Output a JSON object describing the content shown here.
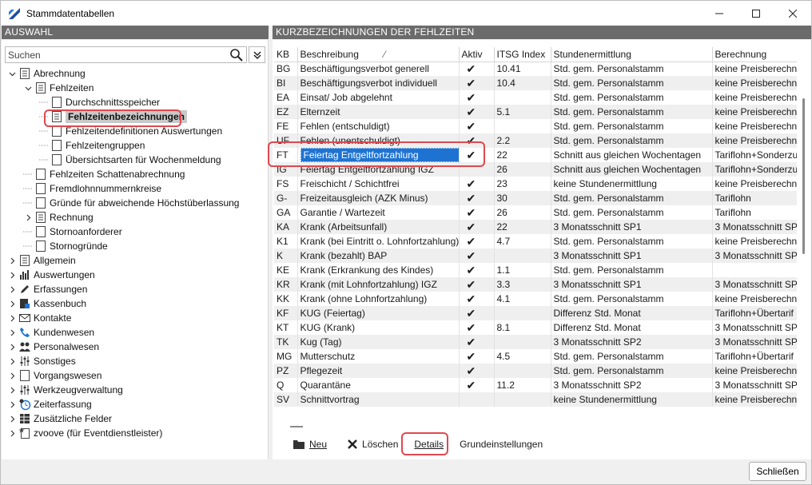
{
  "window": {
    "title": "Stammdatentabellen",
    "minimize": "—",
    "maximize": "☐",
    "close": "✕"
  },
  "left": {
    "header": "AUSWAHL",
    "search": {
      "placeholder": "Suchen",
      "value": ""
    },
    "tree": [
      {
        "label": "Abrechnung",
        "icon": "doc-list-icon",
        "level": 0,
        "expander": "open"
      },
      {
        "label": "Fehlzeiten",
        "icon": "doc-list-icon",
        "level": 1,
        "expander": "open"
      },
      {
        "label": "Durchschnittsspeicher",
        "icon": "page-icon",
        "level": 2,
        "expander": "none"
      },
      {
        "label": "Fehlzeitenbezeichnungen",
        "icon": "doc-list-icon",
        "level": 2,
        "expander": "none",
        "selected": true
      },
      {
        "label": "Fehlzeitendefinitionen Auswertungen",
        "icon": "page-icon",
        "level": 2,
        "expander": "none"
      },
      {
        "label": "Fehlzeitengruppen",
        "icon": "page-icon",
        "level": 2,
        "expander": "none"
      },
      {
        "label": "Übersichtsarten für Wochenmeldung",
        "icon": "page-icon",
        "level": 2,
        "expander": "none"
      },
      {
        "label": "Fehlzeiten Schattenabrechnung",
        "icon": "page-icon",
        "level": 1,
        "expander": "none"
      },
      {
        "label": "Fremdlohnnummernkreise",
        "icon": "page-icon",
        "level": 1,
        "expander": "none"
      },
      {
        "label": "Gründe für abweichende Höchstüberlassung",
        "icon": "page-icon",
        "level": 1,
        "expander": "none"
      },
      {
        "label": "Rechnung",
        "icon": "doc-list-icon",
        "level": 1,
        "expander": "closed"
      },
      {
        "label": "Stornoanforderer",
        "icon": "page-icon",
        "level": 1,
        "expander": "none"
      },
      {
        "label": "Stornogründe",
        "icon": "page-icon",
        "level": 1,
        "expander": "none"
      },
      {
        "label": "Allgemein",
        "icon": "doc-list-icon",
        "level": 0,
        "expander": "closed"
      },
      {
        "label": "Auswertungen",
        "icon": "bar-chart-icon",
        "level": 0,
        "expander": "closed"
      },
      {
        "label": "Erfassungen",
        "icon": "pencil-icon",
        "level": 0,
        "expander": "closed"
      },
      {
        "label": "Kassenbuch",
        "icon": "cash-book-icon",
        "level": 0,
        "expander": "closed"
      },
      {
        "label": "Kontakte",
        "icon": "envelope-icon",
        "level": 0,
        "expander": "closed"
      },
      {
        "label": "Kundenwesen",
        "icon": "phone-icon",
        "level": 0,
        "expander": "closed"
      },
      {
        "label": "Personalwesen",
        "icon": "people-icon",
        "level": 0,
        "expander": "closed"
      },
      {
        "label": "Sonstiges",
        "icon": "sliders-icon",
        "level": 0,
        "expander": "closed"
      },
      {
        "label": "Vorgangswesen",
        "icon": "page-icon",
        "level": 0,
        "expander": "closed"
      },
      {
        "label": "Werkzeugverwaltung",
        "icon": "sliders-icon",
        "level": 0,
        "expander": "closed"
      },
      {
        "label": "Zeiterfassung",
        "icon": "clock-gear-icon",
        "level": 0,
        "expander": "closed"
      },
      {
        "label": "Zusätzliche Felder",
        "icon": "grid-icon",
        "level": 0,
        "expander": "closed"
      },
      {
        "label": "zvoove (für Eventdienstleister)",
        "icon": "star-doc-icon",
        "level": 0,
        "expander": "closed"
      }
    ]
  },
  "right": {
    "header": "KURZBEZEICHNUNGEN DER FEHLZEITEN",
    "columns": [
      "KB",
      "Beschreibung",
      "Aktiv",
      "ITSG Index",
      "Stundenermittlung",
      "Berechnung"
    ],
    "sort_indicator": "⁄",
    "rows": [
      [
        "BG",
        "Beschäftigungsverbot generell",
        "✔",
        "10.41",
        "Std. gem. Personalstamm",
        "keine Preisberechnu"
      ],
      [
        "BI",
        "Beschäftigungsverbot individuell",
        "✔",
        "10.4",
        "Std. gem. Personalstamm",
        "keine Preisberechnu"
      ],
      [
        "EA",
        "Einsat/ Job abgelehnt",
        "✔",
        "",
        "Std. gem. Personalstamm",
        "keine Preisberechnu"
      ],
      [
        "EZ",
        "Elternzeit",
        "✔",
        "5.1",
        "Std. gem. Personalstamm",
        "keine Preisberechnu"
      ],
      [
        "FE",
        "Fehlen (entschuldigt)",
        "✔",
        "",
        "Std. gem. Personalstamm",
        "keine Preisberechnu"
      ],
      [
        "UF",
        "Fehlen (unentschuldigt)",
        "✔",
        "2.2",
        "Std. gem. Personalstamm",
        "keine Preisberechnu"
      ],
      [
        "FT",
        "Feiertag Entgeltfortzahlung",
        "✔",
        "22",
        "Schnitt aus gleichen Wochentagen",
        "Tariflohn+Sonderzu"
      ],
      [
        "IG",
        "Feiertag Entgeltfortzahlung IGZ",
        "",
        "26",
        "Schnitt aus gleichen Wochentagen",
        "Tariflohn+Sonderzu"
      ],
      [
        "FS",
        "Freischicht / Schichtfrei",
        "✔",
        "23",
        "keine Stundenermittlung",
        "keine Preisberechnu"
      ],
      [
        "G-",
        "Freizeitausgleich (AZK Minus)",
        "✔",
        "30",
        "Std. gem. Personalstamm",
        "Tariflohn"
      ],
      [
        "GA",
        "Garantie / Wartezeit",
        "✔",
        "26",
        "Std. gem. Personalstamm",
        "Tariflohn"
      ],
      [
        "KA",
        "Krank (Arbeitsunfall)",
        "✔",
        "22",
        "3 Monatsschnitt SP1",
        "3 Monatsschnitt SP"
      ],
      [
        "K1",
        "Krank (bei Eintritt o. Lohnfortzahlung)",
        "✔",
        "4.7",
        "Std. gem. Personalstamm",
        "keine Preisberechnu"
      ],
      [
        "K",
        "Krank (bezahlt) BAP",
        "✔",
        "",
        "3 Monatsschnitt SP1",
        "3 Monatsschnitt SP"
      ],
      [
        "KE",
        "Krank (Erkrankung des Kindes)",
        "✔",
        "1.1",
        "Std. gem. Personalstamm",
        ""
      ],
      [
        "KR",
        "Krank (mit Lohnfortzahlung) IGZ",
        "✔",
        "3.3",
        "3 Monatsschnitt SP1",
        "3 Monatsschnitt SP"
      ],
      [
        "KK",
        "Krank (ohne Lohnfortzahlung)",
        "✔",
        "4.1",
        "Std. gem. Personalstamm",
        "keine Preisberechnu"
      ],
      [
        "KF",
        "KUG (Feiertag)",
        "✔",
        "",
        "Differenz Std. Monat",
        "Tariflohn+Übertarif"
      ],
      [
        "KT",
        "KUG (Krank)",
        "✔",
        "8.1",
        "Differenz Std. Monat",
        "3 Monatsschnitt SP"
      ],
      [
        "TK",
        "Kug (Tag)",
        "✔",
        "",
        "3 Monatsschnitt SP2",
        "3 Monatsschnitt SP"
      ],
      [
        "MG",
        "Mutterschutz",
        "✔",
        "4.5",
        "Std. gem. Personalstamm",
        "Tariflohn+Übertarif"
      ],
      [
        "PZ",
        "Pflegezeit",
        "✔",
        "",
        "Std. gem. Personalstamm",
        "keine Preisberechnu"
      ],
      [
        "Q",
        "Quarantäne",
        "✔",
        "11.2",
        "3 Monatsschnitt SP2",
        "3 Monatsschnitt SP"
      ],
      [
        "SV",
        "Schnittvortrag",
        "",
        "",
        "keine Stundenermittlung",
        "keine Preisberechnu"
      ]
    ],
    "selected_row": 6,
    "toolbar": {
      "new": "Neu",
      "delete": "Löschen",
      "details": "Details",
      "settings": "Grundeinstellungen"
    }
  },
  "footer": {
    "close": "Schließen"
  },
  "colors": {
    "header_bg": "#6b6b6b",
    "selection": "#1e73d2",
    "highlight": "#e0484f"
  }
}
